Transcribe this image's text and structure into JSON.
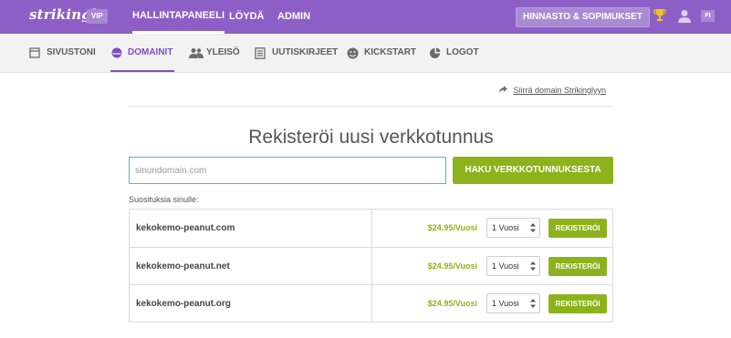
{
  "header": {
    "logo": "strikingly",
    "vip_badge": "VIP",
    "nav": [
      "HALLINTAPANEELI",
      "LÖYDÄ",
      "ADMIN"
    ],
    "pricing_button": "HINNASTO & SOPIMUKSET",
    "lang": "FI",
    "icons": [
      "trophy-icon",
      "user-icon"
    ]
  },
  "subnav": {
    "items": [
      {
        "label": "SIVUSTONI",
        "icon": "page-icon"
      },
      {
        "label": "DOMAINIT",
        "icon": "www-icon"
      },
      {
        "label": "YLEISÖ",
        "icon": "people-icon"
      },
      {
        "label": "UUTISKIRJEET",
        "icon": "newsletter-icon"
      },
      {
        "label": "KICKSTART",
        "icon": "smile-icon"
      },
      {
        "label": "LOGOT",
        "icon": "logo-icon"
      }
    ]
  },
  "main": {
    "transfer_link": "Siirrä domain Strikinglyyn",
    "title": "Rekisteröi uusi verkkotunnus",
    "search_placeholder": "sinundomain.com",
    "search_button": "HAKU VERKKOTUNNUKSESTA",
    "suggestions_label": "Suosituksia sinulle:",
    "suggestions": [
      {
        "domain": "kekokemo-peanut.com",
        "price": "$24.95/Vuosi",
        "period": "1 Vuosi",
        "button": "REKISTERÖI"
      },
      {
        "domain": "kekokemo-peanut.net",
        "price": "$24.95/Vuosi",
        "period": "1 Vuosi",
        "button": "REKISTERÖI"
      },
      {
        "domain": "kekokemo-peanut.org",
        "price": "$24.95/Vuosi",
        "period": "1 Vuosi",
        "button": "REKISTERÖI"
      }
    ]
  },
  "colors": {
    "brand_purple": "#8d5fc6",
    "accent_green": "#8cb31c",
    "input_border": "#4db3d3"
  }
}
